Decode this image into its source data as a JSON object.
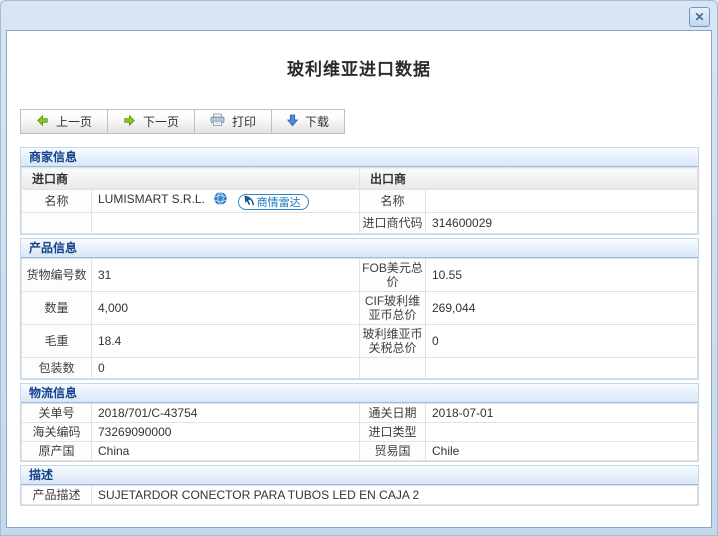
{
  "page": {
    "title": "玻利维亚进口数据"
  },
  "toolbar": {
    "prev": "上一页",
    "next": "下一页",
    "print": "打印",
    "download": "下载"
  },
  "icons": {
    "close": "✕",
    "prev": "green-arrow-left",
    "next": "green-arrow-right",
    "print": "printer",
    "download": "blue-arrow-down",
    "website": "globe",
    "radar": "radar-pointer"
  },
  "sections": {
    "merchant": {
      "title": "商家信息",
      "importer_header": "进口商",
      "exporter_header": "出口商",
      "importer_name_label": "名称",
      "importer_name": "LUMISMART S.R.L.",
      "radar_badge": "商情雷达",
      "exporter_name_label": "名称",
      "exporter_name": "",
      "importer_code_label": "进口商代码",
      "importer_code": "314600029"
    },
    "product": {
      "title": "产品信息",
      "rows": [
        {
          "l1": "货物编号数",
          "v1": "31",
          "l2": "FOB美元总价",
          "v2": "10.55"
        },
        {
          "l1": "数量",
          "v1": "4,000",
          "l2": "CIF玻利维亚币总价",
          "v2": "269,044"
        },
        {
          "l1": "毛重",
          "v1": "18.4",
          "l2": "玻利维亚币关税总价",
          "v2": "0"
        },
        {
          "l1": "包装数",
          "v1": "0",
          "l2": "",
          "v2": ""
        }
      ]
    },
    "logistics": {
      "title": "物流信息",
      "rows": [
        {
          "l1": "关单号",
          "v1": "2018/701/C-43754",
          "l2": "通关日期",
          "v2": "2018-07-01"
        },
        {
          "l1": "海关编码",
          "v1": "73269090000",
          "l2": "进口类型",
          "v2": ""
        },
        {
          "l1": "原产国",
          "v1": "China",
          "l2": "贸易国",
          "v2": "Chile"
        }
      ]
    },
    "description": {
      "title": "描述",
      "label": "产品描述",
      "value": "SUJETARDOR CONECTOR PARA TUBOS LED EN CAJA 2"
    }
  },
  "colors": {
    "accent_blue": "#15428b",
    "section_border": "#99bbe8",
    "frame_blue": "#c6d8eb",
    "badge_blue": "#1878be",
    "arrow_green": "#7cb51c",
    "arrow_blue": "#4f86d8"
  }
}
